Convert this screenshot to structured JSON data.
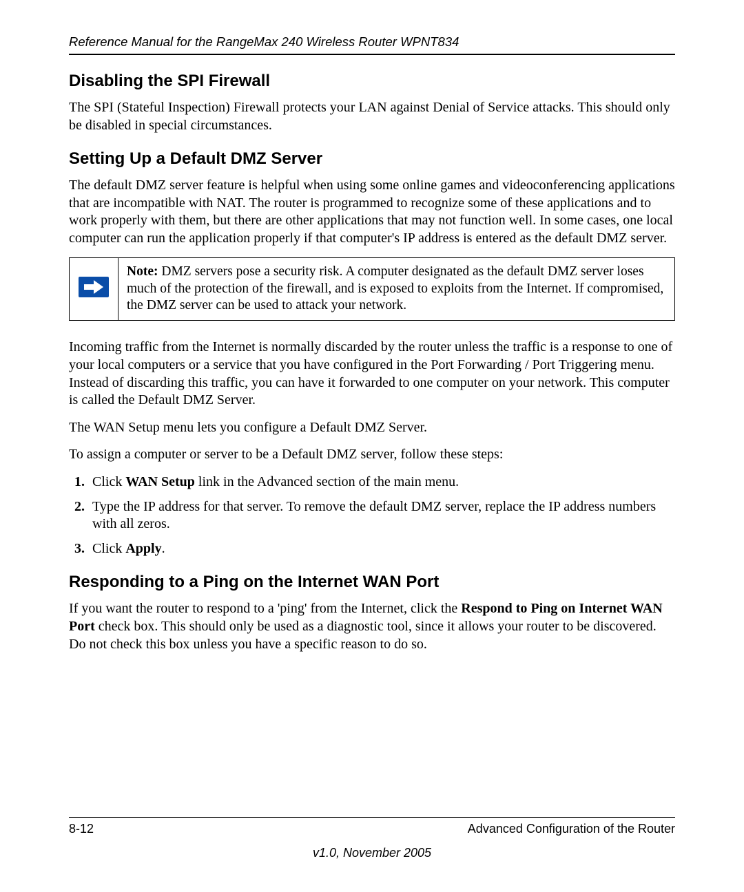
{
  "header": {
    "running_head": "Reference Manual for the RangeMax 240 Wireless Router WPNT834"
  },
  "sections": {
    "spi": {
      "title": "Disabling the SPI Firewall",
      "p1": "The SPI (Stateful Inspection) Firewall protects your LAN against Denial of Service attacks. This should only be disabled in special circumstances."
    },
    "dmz": {
      "title": "Setting Up a Default DMZ Server",
      "p1": "The default DMZ server feature is helpful when using some online games and videoconferencing applications that are incompatible with NAT. The router is programmed to recognize some of these applications and to work properly with them, but there are other applications that may not function well. In some cases, one local computer can run the application properly if that computer's IP address is entered as the default DMZ server.",
      "note_label": "Note:",
      "note_body": " DMZ servers pose a security risk. A computer designated as the default DMZ server loses much of the protection of the firewall, and is exposed to exploits from the Internet. If compromised, the DMZ server can be used to attack your network.",
      "p2": "Incoming traffic from the Internet is normally discarded by the router unless the traffic is a response to one of your local computers or a service that you have configured in the Port Forwarding / Port Triggering menu. Instead of discarding this traffic, you can have it forwarded to one computer on your network. This computer is called the Default DMZ Server.",
      "p3": "The WAN Setup menu lets you configure a Default DMZ Server.",
      "p4": "To assign a computer or server to be a Default DMZ server, follow these steps:",
      "steps": {
        "s1_a": "Click ",
        "s1_b": "WAN Setup",
        "s1_c": " link in the Advanced section of the main menu.",
        "s2": "Type the IP address for that server. To remove the default DMZ server, replace the IP address numbers with all zeros.",
        "s3_a": "Click ",
        "s3_b": "Apply",
        "s3_c": "."
      }
    },
    "ping": {
      "title": "Responding to a Ping on the Internet WAN Port",
      "p1_a": "If you want the router to respond to a 'ping' from the Internet, click the ",
      "p1_b": "Respond to Ping on Internet WAN Port",
      "p1_c": " check box. This should only be used as a diagnostic tool, since it allows your router to be discovered. Do not check this box unless you have a specific reason to do so."
    }
  },
  "footer": {
    "page_num": "8-12",
    "section_title": "Advanced Configuration of the Router",
    "version": "v1.0, November 2005"
  }
}
